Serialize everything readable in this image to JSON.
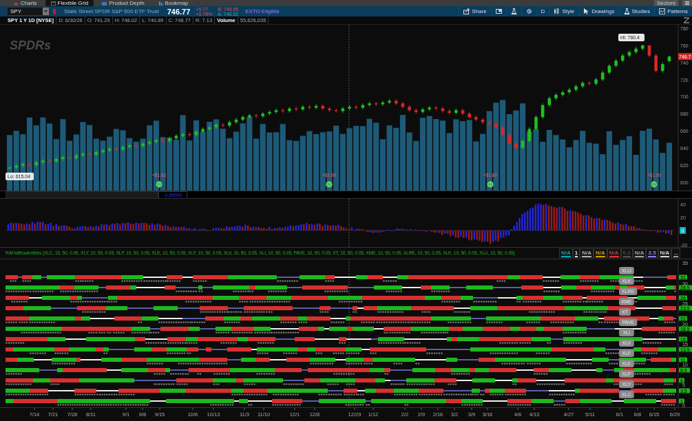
{
  "top_tabs": [
    {
      "label": "Charts",
      "selected": false
    },
    {
      "label": "Flexible Grid",
      "selected": true
    },
    {
      "label": "Product Depth",
      "selected": false
    },
    {
      "label": "Bookmap",
      "selected": false
    }
  ],
  "top_right": {
    "label": "Sectors"
  },
  "symbol_bar": {
    "symbol": "SPY",
    "description": "State Street SPDR S&P 500 ETF Trust",
    "last": "746.77",
    "change": "+5.77",
    "change_pct": "+0.78%",
    "bid": "B: 745.95",
    "ask": "A: 746.02",
    "badge": "EXTO Eligible"
  },
  "toolbar": {
    "share": "Share",
    "timeframe": "D",
    "style": "Style",
    "drawings": "Drawings",
    "studies": "Studies",
    "patterns": "Patterns"
  },
  "info_bar": [
    {
      "kind": "header",
      "text": "SPY 1 Y 1D [NYSE]"
    },
    {
      "kind": "field",
      "text": "D: 6/30/26"
    },
    {
      "kind": "field",
      "text": "O: 741.29"
    },
    {
      "kind": "field",
      "text": "H: 748.02"
    },
    {
      "kind": "field",
      "text": "L: 740.89"
    },
    {
      "kind": "field",
      "text": "C: 746.77"
    },
    {
      "kind": "field",
      "text": "R: 7.13"
    },
    {
      "kind": "header",
      "text": "Volume"
    },
    {
      "kind": "field",
      "text": "55,626,035"
    }
  ],
  "price_pane": {
    "logo": "SPDRs",
    "last_price": "746.7",
    "high_label": "Hi: 760.4",
    "low_label": "Lo: 615.04",
    "dividends": [
      "+$1.83",
      "+$1.99",
      "+$1.80",
      "+$1.90"
    ],
    "chart_data": {
      "type": "candlestick",
      "ylim": [
        590,
        784
      ],
      "yticks": [
        780,
        760,
        740,
        720,
        700,
        680,
        660,
        640,
        620,
        600
      ],
      "ohlc": [
        [
          616,
          618,
          615.04,
          617
        ],
        [
          617,
          621,
          615,
          619
        ],
        [
          619,
          623,
          617,
          621
        ],
        [
          621,
          623,
          618,
          620
        ],
        [
          620,
          625,
          618,
          623
        ],
        [
          623,
          627,
          621,
          625
        ],
        [
          625,
          627,
          622,
          624
        ],
        [
          624,
          629,
          622,
          627
        ],
        [
          627,
          631,
          625,
          629
        ],
        [
          629,
          631,
          626,
          628
        ],
        [
          628,
          633,
          626,
          631
        ],
        [
          631,
          635,
          629,
          633
        ],
        [
          633,
          635,
          630,
          632
        ],
        [
          632,
          637,
          630,
          635
        ],
        [
          635,
          639,
          633,
          637
        ],
        [
          637,
          641,
          635,
          639
        ],
        [
          639,
          641,
          636,
          638
        ],
        [
          638,
          643,
          636,
          641
        ],
        [
          641,
          645,
          639,
          643
        ],
        [
          643,
          645,
          640,
          642
        ],
        [
          642,
          647,
          640,
          645
        ],
        [
          645,
          649,
          643,
          647
        ],
        [
          647,
          651,
          645,
          649
        ],
        [
          649,
          651,
          646,
          648
        ],
        [
          648,
          653,
          646,
          651
        ],
        [
          651,
          656,
          649,
          654
        ],
        [
          654,
          658,
          652,
          656
        ],
        [
          656,
          658,
          653,
          655
        ],
        [
          655,
          661,
          653,
          659
        ],
        [
          659,
          664,
          657,
          662
        ],
        [
          662,
          666,
          660,
          664
        ],
        [
          664,
          669,
          662,
          667
        ],
        [
          667,
          669,
          664,
          666
        ],
        [
          666,
          672,
          664,
          670
        ],
        [
          670,
          675,
          668,
          673
        ],
        [
          673,
          678,
          671,
          676
        ],
        [
          676,
          680,
          674,
          678
        ],
        [
          678,
          680,
          675,
          677
        ],
        [
          677,
          682,
          675,
          680
        ],
        [
          680,
          684,
          678,
          682
        ],
        [
          682,
          686,
          680,
          684
        ],
        [
          684,
          686,
          681,
          683
        ],
        [
          683,
          688,
          681,
          686
        ],
        [
          686,
          688,
          683,
          685
        ],
        [
          685,
          690,
          683,
          688
        ],
        [
          688,
          690,
          685,
          687
        ],
        [
          687,
          691,
          685,
          689
        ],
        [
          689,
          691,
          684,
          686
        ],
        [
          686,
          688,
          682,
          684
        ],
        [
          684,
          686,
          681,
          683
        ],
        [
          683,
          688,
          681,
          686
        ],
        [
          686,
          690,
          684,
          688
        ],
        [
          688,
          690,
          685,
          687
        ],
        [
          687,
          692,
          685,
          690
        ],
        [
          690,
          694,
          688,
          692
        ],
        [
          692,
          694,
          689,
          691
        ],
        [
          691,
          695,
          689,
          693
        ],
        [
          693,
          697,
          691,
          695
        ],
        [
          695,
          697,
          690,
          692
        ],
        [
          692,
          694,
          686,
          688
        ],
        [
          688,
          690,
          682,
          684
        ],
        [
          684,
          686,
          680,
          682
        ],
        [
          682,
          687,
          680,
          685
        ],
        [
          685,
          689,
          683,
          687
        ],
        [
          687,
          689,
          684,
          686
        ],
        [
          686,
          688,
          681,
          683
        ],
        [
          683,
          685,
          679,
          681
        ],
        [
          681,
          686,
          679,
          684
        ],
        [
          684,
          686,
          678,
          680
        ],
        [
          680,
          682,
          674,
          676
        ],
        [
          676,
          678,
          671,
          673
        ],
        [
          673,
          675,
          668,
          670
        ],
        [
          670,
          672,
          666,
          668
        ],
        [
          668,
          670,
          662,
          664
        ],
        [
          664,
          666,
          653,
          655
        ],
        [
          655,
          657,
          643,
          645
        ],
        [
          645,
          647,
          638,
          640
        ],
        [
          640,
          650,
          638,
          648
        ],
        [
          648,
          664,
          646,
          662
        ],
        [
          662,
          678,
          660,
          676
        ],
        [
          676,
          692,
          674,
          690
        ],
        [
          690,
          700,
          688,
          698
        ],
        [
          698,
          704,
          696,
          702
        ],
        [
          702,
          707,
          700,
          705
        ],
        [
          705,
          710,
          703,
          708
        ],
        [
          708,
          714,
          706,
          712
        ],
        [
          712,
          718,
          710,
          716
        ],
        [
          716,
          718,
          713,
          715
        ],
        [
          715,
          722,
          713,
          720
        ],
        [
          720,
          730,
          718,
          728
        ],
        [
          728,
          738,
          726,
          736
        ],
        [
          736,
          744,
          734,
          742
        ],
        [
          742,
          750,
          740,
          748
        ],
        [
          748,
          754,
          746,
          752
        ],
        [
          752,
          758,
          750,
          756
        ],
        [
          756,
          760.4,
          754,
          760
        ],
        [
          760,
          760,
          746,
          748
        ],
        [
          748,
          750,
          728,
          730
        ],
        [
          730,
          740,
          728,
          738
        ],
        [
          741.29,
          748.02,
          740.89,
          746.77
        ]
      ]
    }
  },
  "readout_pane": {
    "value": "-3.89942"
  },
  "histogram_pane": {
    "y_ticks": [
      "40",
      "20",
      "-20"
    ],
    "zero_badge": "0"
  },
  "study_row": {
    "title": "RAFwithoutentries (XLC, 10, 50, 0.05, XLY, 10, 50, 0.05, XLP, 10, 50, 0.05, XLE, 10, 50, 0.05, XLF, 10, 50, 0.05, XLV, 10, 50, 0.05, XLI, 10, 50, 0.05, PAVE, 10, 50, 0.05, XT, 10, 50, 0.05, XME, 10, 50, 0.05, XLRE, 10, 50, 0.05, XLK, 10, 50, 0.05, XLU, 10, 50, 0.05)",
    "badges": [
      {
        "text": "N/A",
        "color": "#00a8b8"
      },
      {
        "text": "1",
        "color": "#e0e0e0"
      },
      {
        "text": "N/A",
        "color": "#b0b0b0"
      },
      {
        "text": "N/A",
        "color": "#d09a00"
      },
      {
        "text": "N/A",
        "color": "#d03838"
      },
      {
        "text": "0.2",
        "color": "#505050"
      },
      {
        "text": "N/A",
        "color": "#a0a0a0"
      },
      {
        "text": "3.5",
        "color": "#8080f0"
      },
      {
        "text": "N/A",
        "color": "#d8d8d8"
      },
      {
        "text": "...",
        "color": "#a0a0a0"
      }
    ]
  },
  "signals_pane": {
    "rows": [
      {
        "symbol": "XLU",
        "value": "31"
      },
      {
        "symbol": "XLK",
        "value": "28.5"
      },
      {
        "symbol": "XLRE",
        "value": "26"
      },
      {
        "symbol": "XME",
        "value": "23.5"
      },
      {
        "symbol": "XT",
        "value": "21"
      },
      {
        "symbol": "PAVE",
        "value": "18.5"
      },
      {
        "symbol": "XLI",
        "value": "16"
      },
      {
        "symbol": "XLV",
        "value": "13.5"
      },
      {
        "symbol": "XLF",
        "value": "11"
      },
      {
        "symbol": "XLE",
        "value": "8.5"
      },
      {
        "symbol": "XLP",
        "value": "6"
      },
      {
        "symbol": "XLY",
        "value": "3.5"
      },
      {
        "symbol": "XLC",
        "value": "1"
      }
    ],
    "y_ticks": [
      "35",
      "30",
      "25",
      "20",
      "15",
      "10",
      "5",
      "0"
    ]
  },
  "x_axis": [
    "7/14",
    "7/21",
    "7/28",
    "8/11",
    "9/1",
    "9/8",
    "9/15",
    "10/6",
    "10/13",
    "11/3",
    "11/10",
    "12/1",
    "12/8",
    "12/29",
    "1/12",
    "2/2",
    "2/9",
    "2/16",
    "3/2",
    "3/9",
    "3/16",
    "4/6",
    "4/13",
    "4/27",
    "5/11",
    "6/1",
    "6/8",
    "6/15",
    "6/29"
  ]
}
